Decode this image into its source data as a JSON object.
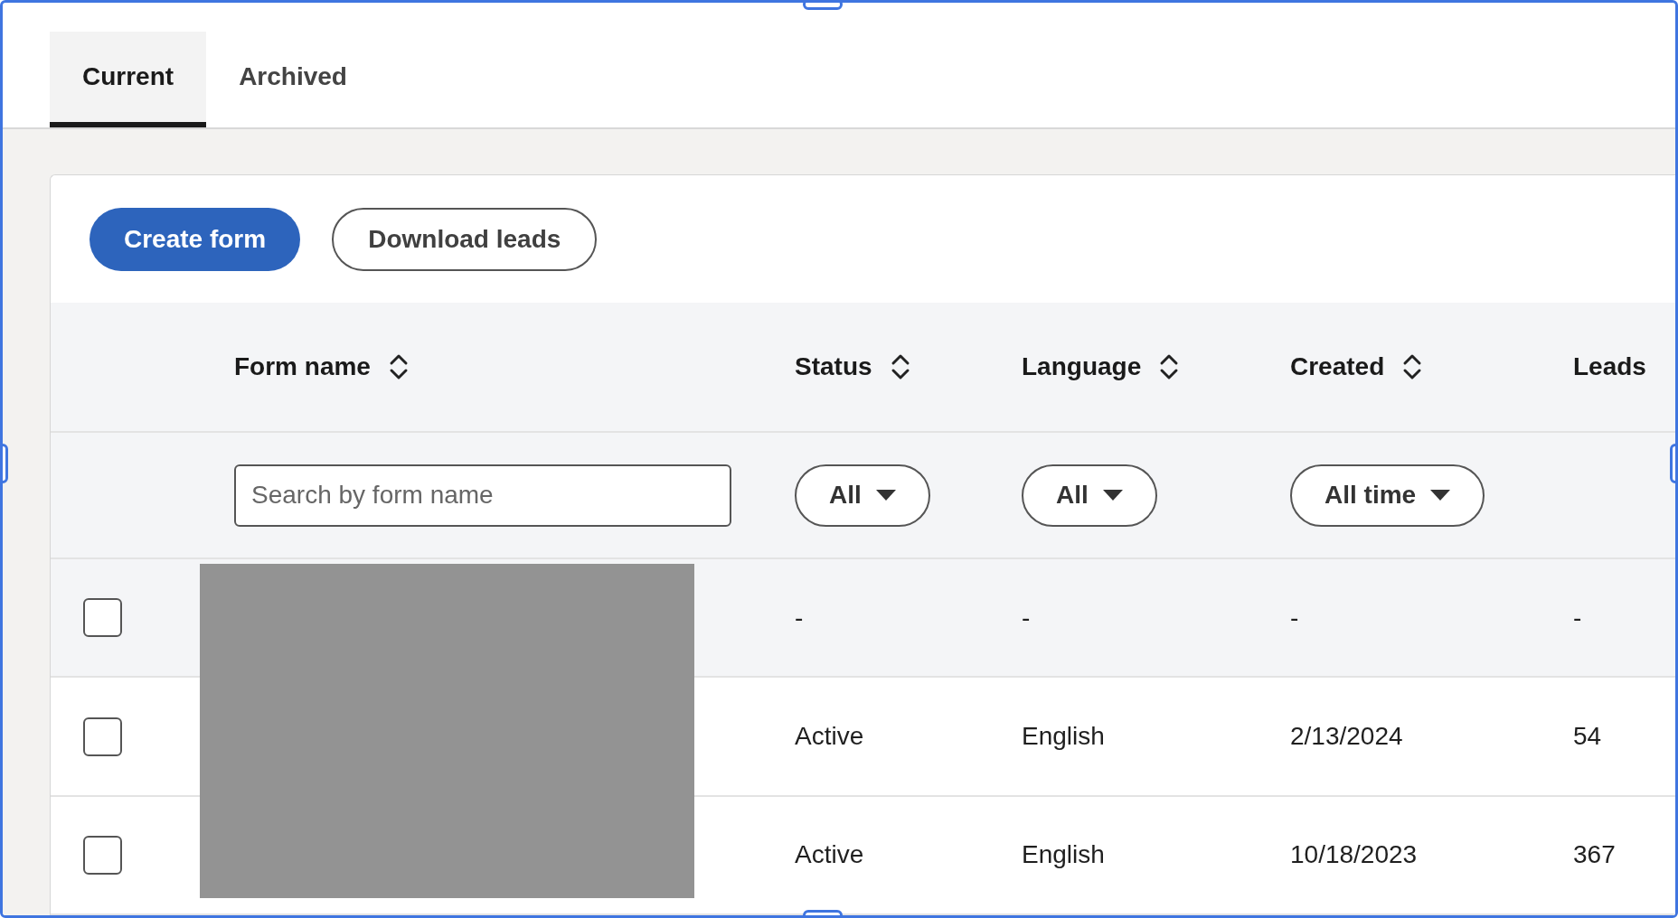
{
  "tabs": [
    {
      "label": "Current",
      "selected": true
    },
    {
      "label": "Archived",
      "selected": false
    }
  ],
  "actions": [
    {
      "label": "Create form",
      "kind": "primary"
    },
    {
      "label": "Download leads",
      "kind": "secondary"
    }
  ],
  "table": {
    "columns": [
      {
        "label": "Form name",
        "sortable": true
      },
      {
        "label": "Status",
        "sortable": true
      },
      {
        "label": "Language",
        "sortable": true
      },
      {
        "label": "Created",
        "sortable": true
      },
      {
        "label": "Leads",
        "sortable": false
      }
    ],
    "filters": {
      "search": {
        "placeholder": "Search by form name"
      },
      "dropdowns": [
        {
          "value": "All"
        },
        {
          "value": "All"
        },
        {
          "value": "All time"
        }
      ]
    },
    "rows": [
      {
        "checked": false,
        "kind": "summary",
        "cells": [
          "",
          "-",
          "-",
          "-",
          "-"
        ]
      },
      {
        "checked": false,
        "kind": "form",
        "cells": [
          "",
          "Active",
          "English",
          "2/13/2024",
          "54"
        ]
      },
      {
        "checked": false,
        "kind": "form",
        "cells": [
          "",
          "Active",
          "English",
          "10/18/2023",
          "367"
        ]
      }
    ]
  }
}
